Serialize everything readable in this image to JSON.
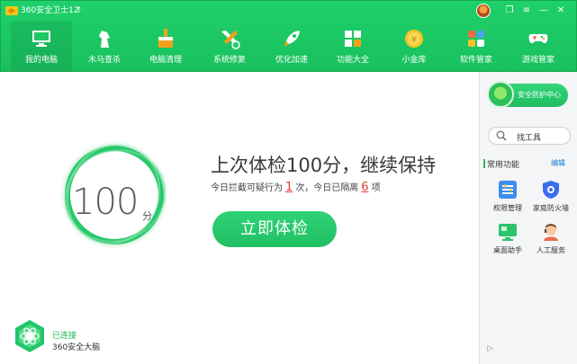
{
  "window": {
    "title": "360安全卫士12",
    "upgrade_glyph": "↑",
    "controls": [
      "❒",
      "≡",
      "—",
      "✕"
    ]
  },
  "nav": {
    "items": [
      {
        "label": "我的电脑",
        "icon": "computer-icon",
        "active": true
      },
      {
        "label": "木马查杀",
        "icon": "trojan-horse-icon"
      },
      {
        "label": "电脑清理",
        "icon": "broom-icon"
      },
      {
        "label": "系统修复",
        "icon": "wrench-icon"
      },
      {
        "label": "优化加速",
        "icon": "rocket-icon"
      },
      {
        "label": "功能大全",
        "icon": "grid-icon"
      },
      {
        "label": "小金库",
        "icon": "coin-icon"
      },
      {
        "label": "软件管家",
        "icon": "apps-icon"
      },
      {
        "label": "游戏管家",
        "icon": "gamepad-icon"
      }
    ]
  },
  "main": {
    "score": "100",
    "score_unit": "分",
    "headline": "上次体检100分，继续保持",
    "sub": {
      "prefix": "今日拦截可疑行为",
      "blocked": "1",
      "middle": "次，今日已隔离",
      "isolated": "6",
      "suffix": "项"
    },
    "exam_button": "立即体检",
    "connection": {
      "status": "已连接",
      "label": "360安全大脑"
    }
  },
  "sidebar": {
    "center_button": "安全防护中心",
    "search_label": "找工具",
    "section_title": "常用功能",
    "edit_label": "编辑",
    "tools": [
      {
        "label": "权限管理",
        "icon": "permission-icon"
      },
      {
        "label": "家庭防火墙",
        "icon": "firewall-icon"
      },
      {
        "label": "桌面助手",
        "icon": "desktop-assistant-icon"
      },
      {
        "label": "人工服务",
        "icon": "customer-service-icon"
      }
    ],
    "collapse_glyph": "▷"
  },
  "colors": {
    "brand_green": "#19c15e",
    "accent_red": "#e53b2e",
    "link_blue": "#1a7fd6"
  }
}
